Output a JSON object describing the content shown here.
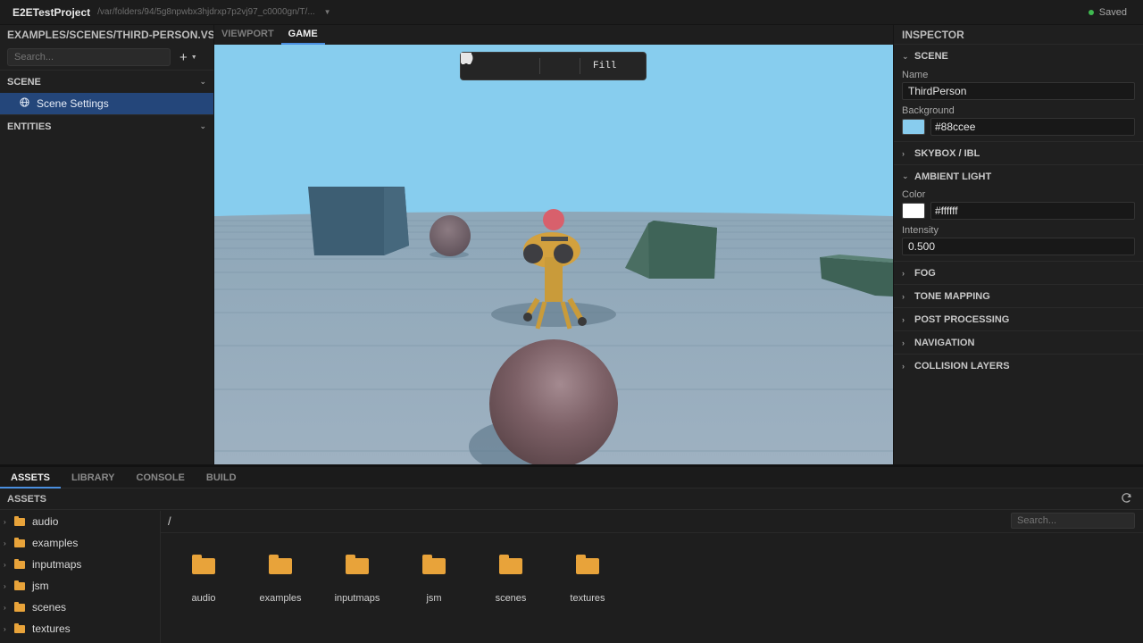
{
  "topbar": {
    "project_name": "E2ETestProject",
    "project_path": "/var/folders/94/5g8npwbx3hjdrxp7p2vj97_c0000gn/T/...",
    "saved_label": "Saved",
    "saved_color": "#3fb950"
  },
  "left_panel": {
    "scene_path": "EXAMPLES/SCENES/THIRD-PERSON.VSCN",
    "search_placeholder": "Search...",
    "add_icon": "+",
    "scene_section": "SCENE",
    "scene_item": "Scene Settings",
    "entities_section": "ENTITIES"
  },
  "viewport_tabs": [
    {
      "label": "VIEWPORT",
      "active": false
    },
    {
      "label": "GAME",
      "active": true
    }
  ],
  "game_toolbar": {
    "pause_icon": "pause-icon",
    "stop_icon": "stop-icon",
    "volume_icon": "volume-icon",
    "display_icon": "monitor-icon",
    "fill_label": "Fill"
  },
  "inspector": {
    "title": "INSPECTOR",
    "scene_section": "SCENE",
    "name_label": "Name",
    "name_value": "ThirdPerson",
    "background_label": "Background",
    "background_value": "#88ccee",
    "skybox_section": "SKYBOX / IBL",
    "ambient_section": "AMBIENT LIGHT",
    "color_label": "Color",
    "color_value": "#ffffff",
    "intensity_label": "Intensity",
    "intensity_value": "0.500",
    "collapsed_sections": [
      "FOG",
      "TONE MAPPING",
      "POST PROCESSING",
      "NAVIGATION",
      "COLLISION LAYERS"
    ]
  },
  "bottom_tabs": [
    {
      "label": "ASSETS",
      "active": true
    },
    {
      "label": "LIBRARY",
      "active": false
    },
    {
      "label": "CONSOLE",
      "active": false
    },
    {
      "label": "BUILD",
      "active": false
    }
  ],
  "assets": {
    "header": "ASSETS",
    "breadcrumb": "/",
    "search_placeholder": "Search...",
    "tree": [
      "audio",
      "examples",
      "inputmaps",
      "jsm",
      "scenes",
      "textures"
    ],
    "grid": [
      "audio",
      "examples",
      "inputmaps",
      "jsm",
      "scenes",
      "textures"
    ],
    "folder_color": "#e8a33a"
  },
  "colors": {
    "accent": "#4a8fe0",
    "selected_row": "#24467a",
    "sky": "#88ccee"
  }
}
